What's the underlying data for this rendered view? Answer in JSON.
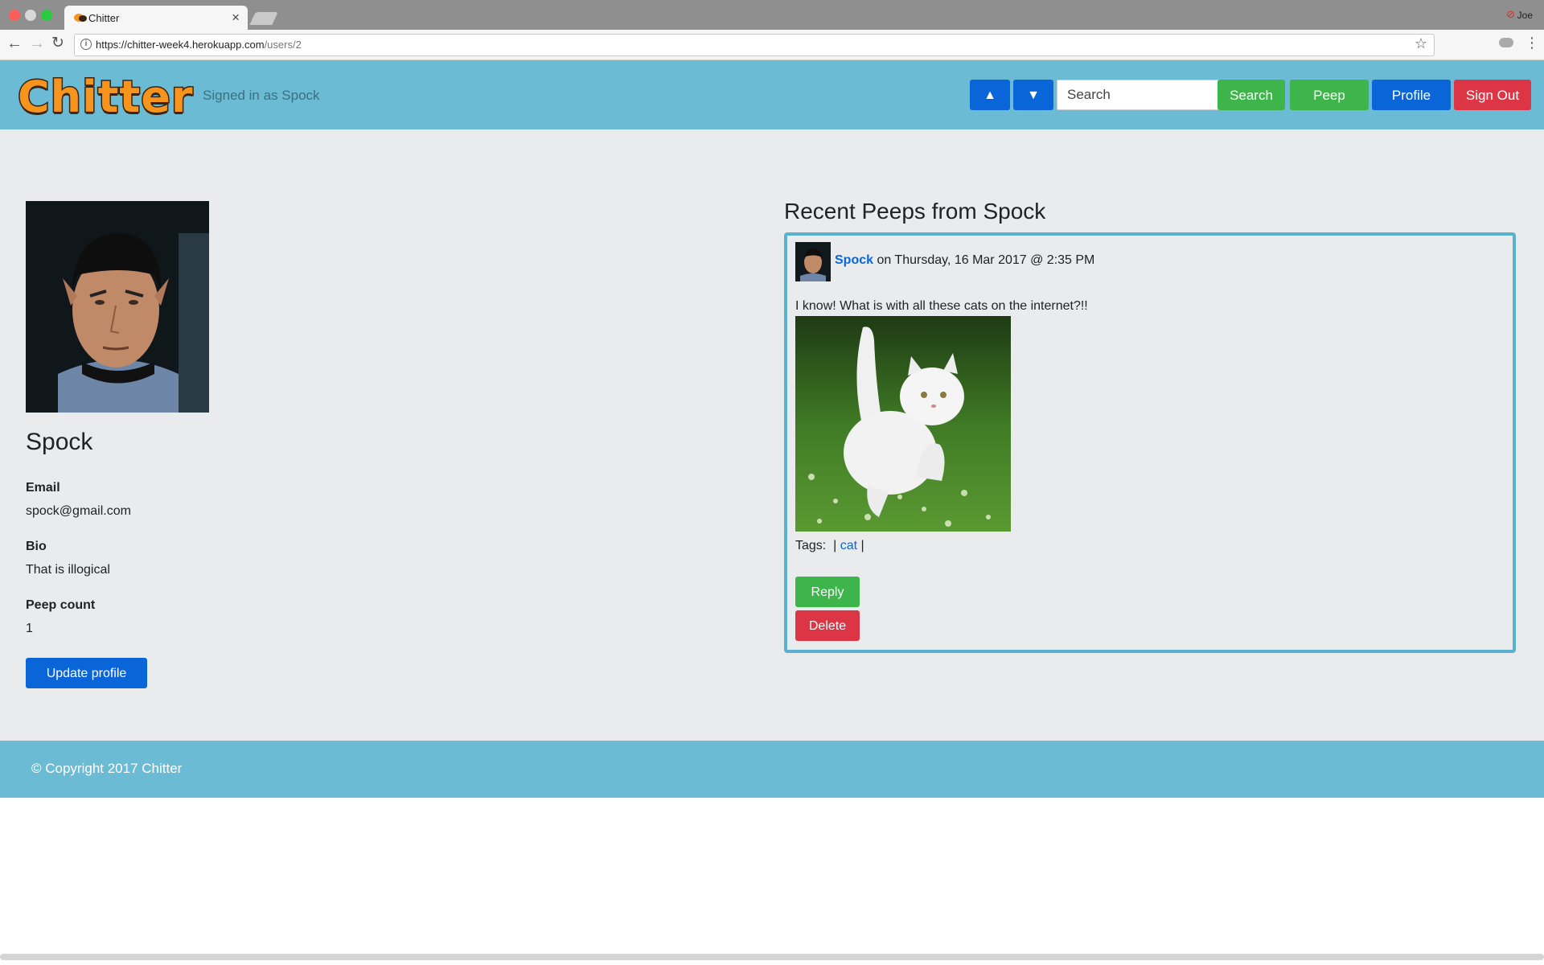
{
  "browser": {
    "tab_title": "Chitter",
    "url_domain": "https://chitter-week4.herokuapp.com",
    "url_path": "/users/2",
    "profile_name": "Joe"
  },
  "header": {
    "logo_text": "Chitter",
    "signed_in_text": "Signed in as Spock",
    "up_symbol": "▲",
    "down_symbol": "▼",
    "search_placeholder": "Search",
    "search_label": "Search",
    "peep_label": "Peep",
    "profile_label": "Profile",
    "signout_label": "Sign Out"
  },
  "profile": {
    "name": "Spock",
    "email_label": "Email",
    "email": "spock@gmail.com",
    "bio_label": "Bio",
    "bio": "That is illogical",
    "peep_count_label": "Peep count",
    "peep_count": "1",
    "update_label": "Update profile"
  },
  "peeps": {
    "title": "Recent Peeps from Spock",
    "items": [
      {
        "author": "Spock",
        "date_text": "on Thursday, 16 Mar 2017 @ 2:35 PM",
        "text": "I know! What is with all these cats on the internet?!!",
        "tags_label": "Tags:",
        "tags": [
          "cat"
        ],
        "reply_label": "Reply",
        "delete_label": "Delete"
      }
    ]
  },
  "footer": {
    "copyright": "© Copyright 2017 Chitter"
  },
  "colors": {
    "header_bg": "#6bbbd4",
    "primary": "#0a66d8",
    "success": "#3db54a",
    "danger": "#dc3545",
    "logo": "#f7941d"
  }
}
